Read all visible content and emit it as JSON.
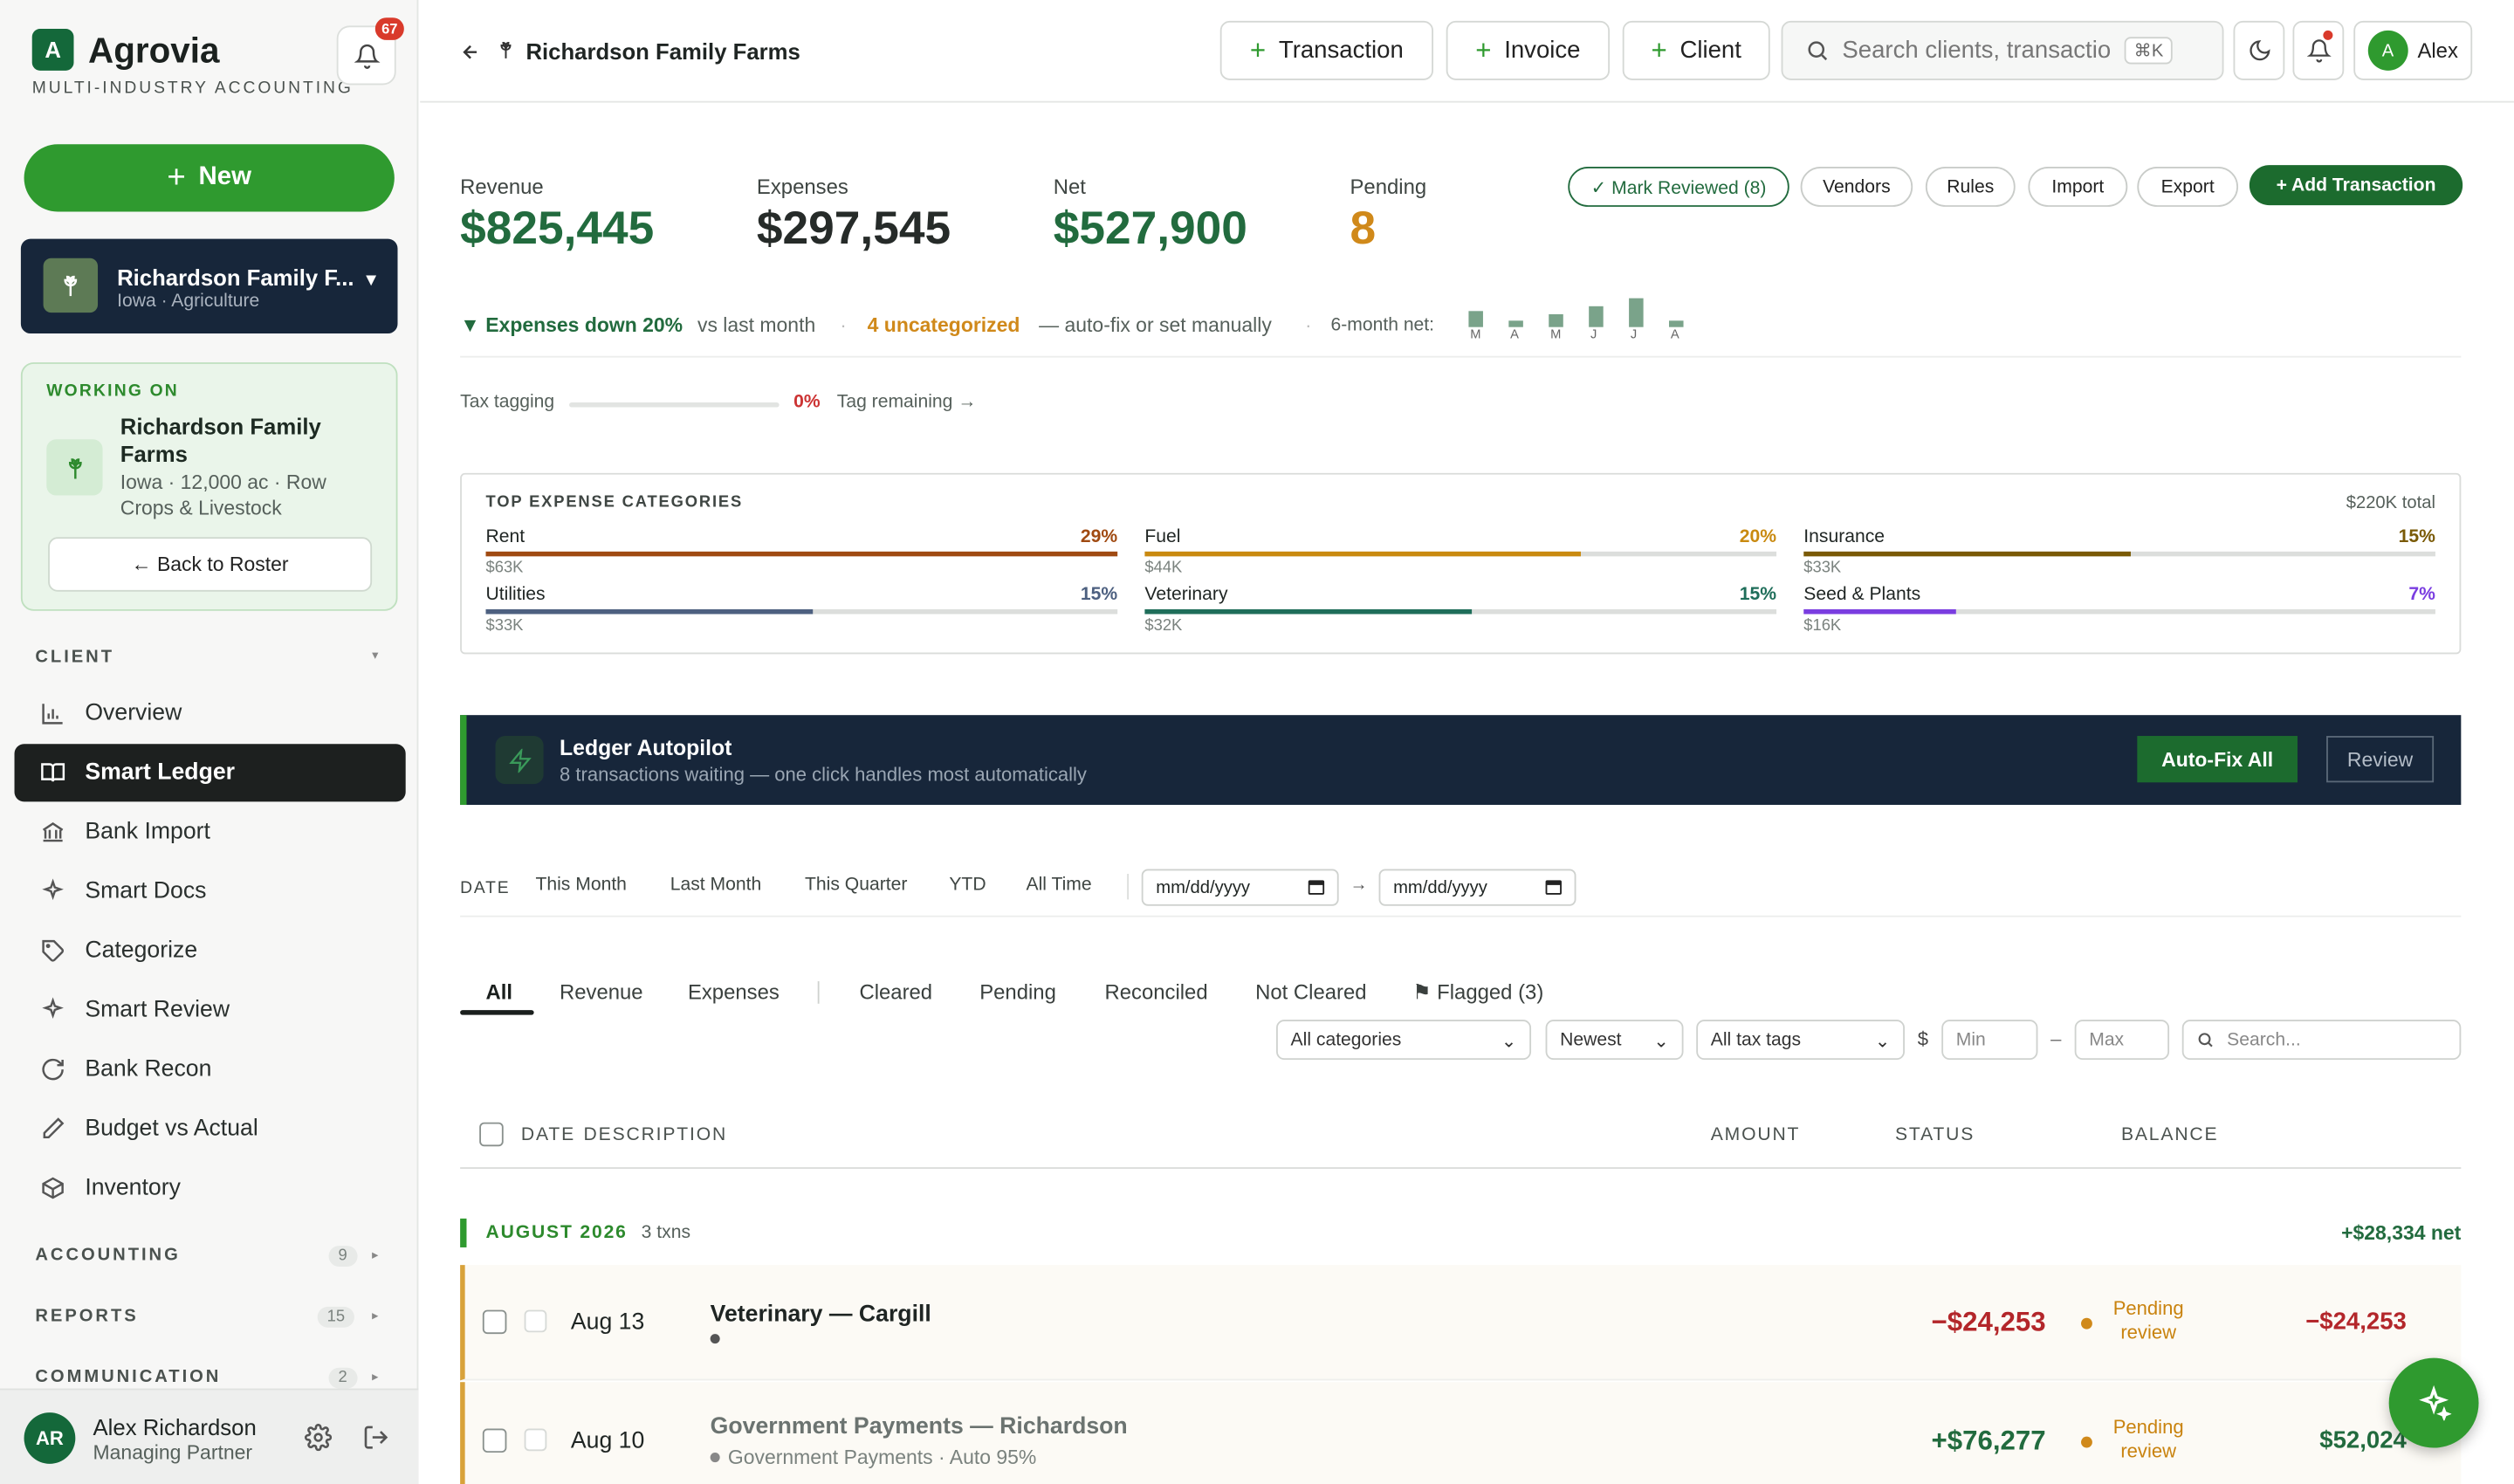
{
  "app": {
    "name": "Agrovia",
    "tagline": "MULTI-INDUSTRY ACCOUNTING",
    "notif_count": "67",
    "new_label": "New"
  },
  "client_switcher": {
    "name": "Richardson Family F...",
    "sub": "Iowa · Agriculture"
  },
  "working_on": {
    "label": "WORKING ON",
    "name": "Richardson Family Farms",
    "detail": "Iowa · 12,000 ac · Row Crops & Livestock",
    "back": "← Back to Roster"
  },
  "nav": {
    "client_label": "CLIENT",
    "items": [
      {
        "label": "Overview",
        "icon": "chart-bar-icon"
      },
      {
        "label": "Smart Ledger",
        "icon": "book-open-icon"
      },
      {
        "label": "Bank Import",
        "icon": "bank-icon"
      },
      {
        "label": "Smart Docs",
        "icon": "sparkles-icon"
      },
      {
        "label": "Categorize",
        "icon": "tag-icon"
      },
      {
        "label": "Smart Review",
        "icon": "sparkles-icon"
      },
      {
        "label": "Bank Recon",
        "icon": "refresh-icon"
      },
      {
        "label": "Budget vs Actual",
        "icon": "pencil-icon"
      },
      {
        "label": "Inventory",
        "icon": "box-icon"
      }
    ],
    "sections": [
      {
        "label": "ACCOUNTING",
        "count": "9"
      },
      {
        "label": "REPORTS",
        "count": "15"
      },
      {
        "label": "COMMUNICATION",
        "count": "2"
      }
    ]
  },
  "user": {
    "initials": "AR",
    "name": "Alex Richardson",
    "role": "Managing Partner"
  },
  "header": {
    "title": "Richardson Family Farms",
    "btn_transaction": "Transaction",
    "btn_invoice": "Invoice",
    "btn_client": "Client",
    "search_placeholder": "Search clients, transactio",
    "shortcut": "⌘K",
    "user_initial": "A",
    "user_name": "Alex"
  },
  "kpis": {
    "revenue_label": "Revenue",
    "revenue": "$825,445",
    "expenses_label": "Expenses",
    "expenses": "$297,545",
    "net_label": "Net",
    "net": "$527,900",
    "pending_label": "Pending",
    "pending": "8"
  },
  "actions": {
    "mark_reviewed": "✓ Mark Reviewed (8)",
    "vendors": "Vendors",
    "rules": "Rules",
    "import": "Import",
    "export": "Export",
    "add": "+ Add Transaction"
  },
  "insights": {
    "trend": "▼ Expenses down 20%",
    "vs": "vs last month",
    "uncat": "4 uncategorized",
    "fix": "— auto-fix or set manually",
    "net6": "6-month net:"
  },
  "spark": {
    "labels": [
      "M",
      "A",
      "M",
      "J",
      "J",
      "A"
    ],
    "values": [
      0.55,
      0.2,
      0.45,
      0.75,
      1.0,
      0.2
    ]
  },
  "tax": {
    "label": "Tax tagging",
    "pct": "0%",
    "link": "Tag remaining →",
    "progress": 0
  },
  "top_expenses": {
    "title": "TOP EXPENSE CATEGORIES",
    "total": "$220K total",
    "items": [
      {
        "name": "Rent",
        "pct": "29%",
        "amount": "$63K",
        "color": "#a04a12"
      },
      {
        "name": "Fuel",
        "pct": "20%",
        "amount": "$44K",
        "color": "#c98a10"
      },
      {
        "name": "Insurance",
        "pct": "15%",
        "amount": "$33K",
        "color": "#7a5a06"
      },
      {
        "name": "Utilities",
        "pct": "15%",
        "amount": "$33K",
        "color": "#4d6080"
      },
      {
        "name": "Veterinary",
        "pct": "15%",
        "amount": "$32K",
        "color": "#1f6e5a"
      },
      {
        "name": "Seed & Plants",
        "pct": "7%",
        "amount": "$16K",
        "color": "#7a3de0"
      }
    ]
  },
  "autopilot": {
    "title": "Ledger Autopilot",
    "sub": "8 transactions waiting — one click handles most automatically",
    "autofix": "Auto-Fix All",
    "review": "Review"
  },
  "date_filter": {
    "label": "DATE",
    "options": [
      "This Month",
      "Last Month",
      "This Quarter",
      "YTD",
      "All Time"
    ],
    "from": "mm/dd/yyyy",
    "to": "mm/dd/yyyy",
    "arrow": "→"
  },
  "tabs": [
    "All",
    "Revenue",
    "Expenses",
    "Cleared",
    "Pending",
    "Reconciled",
    "Not Cleared",
    "⚑ Flagged (3)"
  ],
  "filters": {
    "category": "All categories",
    "sort": "Newest",
    "tax": "All tax tags",
    "currency": "$",
    "min": "Min",
    "dash": "–",
    "max": "Max",
    "search": "Search..."
  },
  "table": {
    "headers": [
      "DATE",
      "DESCRIPTION",
      "AMOUNT",
      "STATUS",
      "BALANCE"
    ],
    "group": {
      "label": "AUGUST 2026",
      "count": "3 txns",
      "net": "+$28,334 net"
    },
    "rows": [
      {
        "date": "Aug 13",
        "desc": "Veterinary — Cargill",
        "sub": "",
        "amount": "−$24,253",
        "status": "Pending review",
        "balance": "−$24,253"
      },
      {
        "date": "Aug 10",
        "desc": "Government Payments — Richardson",
        "sub": "Government Payments · Auto 95%",
        "amount": "+$76,277",
        "status": "Pending review",
        "balance": "$52,024"
      }
    ]
  }
}
